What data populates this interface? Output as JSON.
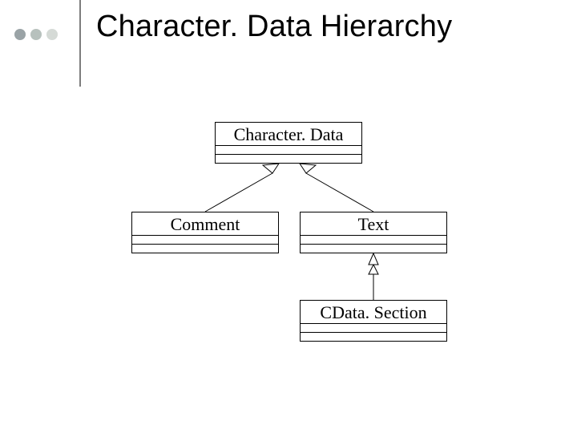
{
  "title": "Character. Data Hierarchy",
  "boxes": {
    "character_data": "Character. Data",
    "comment": "Comment",
    "text": "Text",
    "cdata_section": "CData. Section"
  }
}
